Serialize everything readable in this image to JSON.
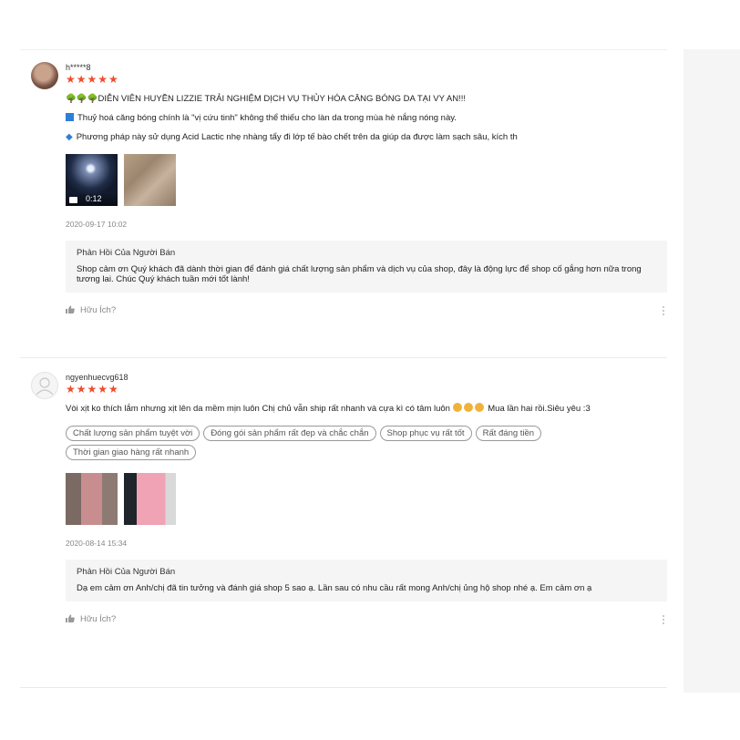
{
  "reviews": [
    {
      "username": "h*****8",
      "rating": 5,
      "stars": "★★★★★",
      "line1": "🌳🌳🌳DIỄN VIÊN HUYỀN LIZZIE TRẢI NGHIỆM DỊCH VỤ THỦY HÓA CĂNG BÓNG DA TẠI VY AN!!!",
      "line1_icons": "tree-icon",
      "line2": "Thuỷ hoá căng bóng chính là \"vị cứu tinh\" không thể thiếu cho làn da trong mùa hè nắng nóng này.",
      "line3": "Phương pháp này sử dụng Acid Lactic nhẹ nhàng tẩy đi lớp tế bào chết trên da giúp da được làm sạch sâu, kích th",
      "video_duration": "0:12",
      "date": "2020-09-17 10:02",
      "reply_title": "Phản Hồi Của Người Bán",
      "reply_text": "Shop cảm ơn Quý khách đã dành thời gian để đánh giá chất lượng sản phẩm và dịch vụ của shop, đây là động lực để  shop cố gắng hơn nữa trong tương lai. Chúc Quý khách tuần mới tốt lành!",
      "helpful": "Hữu Ích?"
    },
    {
      "username": "ngyenhuecvg618",
      "rating": 5,
      "stars": "★★★★★",
      "comment_part1": "Vòi xịt ko thích lắm nhưng xịt lên da mềm mịn luôn Chị chủ vẫn ship rất nhanh và cựa kì có tâm luôn ",
      "comment_part2": " Mua lần hai rồi.Siêu yêu :3",
      "tags": [
        "Chất lượng sản phẩm tuyệt vời",
        "Đóng gói sản phẩm rất đẹp và chắc chắn",
        "Shop phục vụ rất tốt",
        "Rất đáng tiền",
        "Thời gian giao hàng rất nhanh"
      ],
      "date": "2020-08-14 15:34",
      "reply_title": "Phản Hồi Của Người Bán",
      "reply_text": "Dạ em cảm ơn Anh/chị đã tin tưởng và đánh giá shop 5 sao ạ. Lần sau có nhu cầu rất mong Anh/chị ủng hộ shop nhé ạ. Em cảm ơn ạ",
      "helpful": "Hữu Ích?"
    }
  ],
  "colors": {
    "star": "#ee4d2d",
    "icon_blue": "#2f7fd6",
    "reply_bg": "#f5f5f5"
  }
}
